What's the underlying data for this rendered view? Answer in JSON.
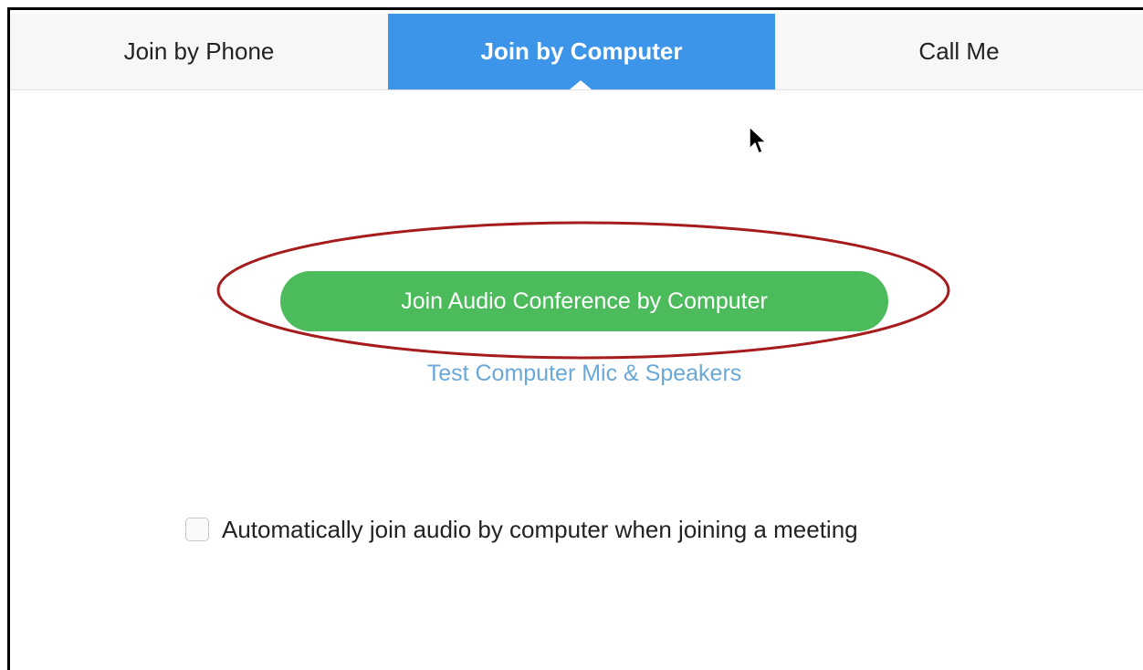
{
  "tabs": {
    "phone": "Join by Phone",
    "computer": "Join by Computer",
    "call_me": "Call Me",
    "active": "computer"
  },
  "main": {
    "join_button": "Join Audio Conference by Computer",
    "test_link": "Test Computer Mic & Speakers",
    "auto_join_label": "Automatically join audio by computer when joining a meeting",
    "auto_join_checked": false
  },
  "colors": {
    "active_tab": "#3d95ea",
    "join_button": "#4cbb5c",
    "link": "#6aa8d8",
    "highlight_ellipse": "#a61c1c"
  },
  "icons": {
    "cursor": "mouse-pointer-icon",
    "highlight": "red-ellipse-annotation"
  }
}
